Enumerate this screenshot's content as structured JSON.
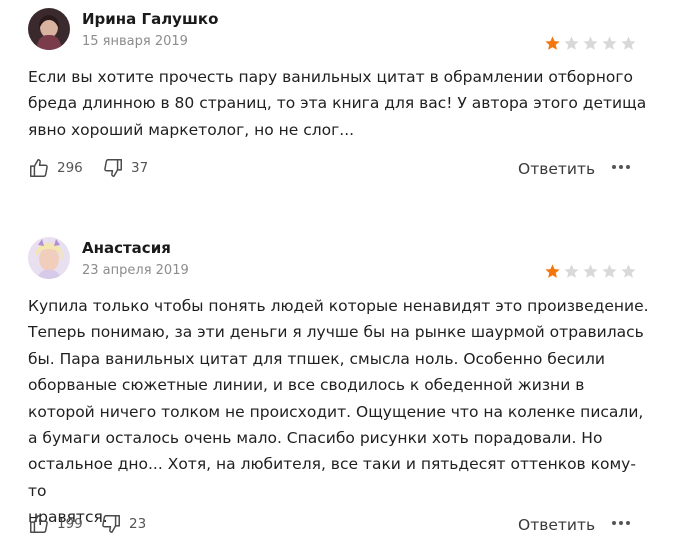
{
  "reviews": [
    {
      "author": "Ирина Галушко",
      "date": "15 января 2019",
      "rating": 1,
      "max_rating": 5,
      "text_lines": [
        "Если вы хотите прочесть пару ванильных цитат в обрамлении отборного",
        "бреда длинною в 80 страниц, то эта книга для вас! У автора этого детища",
        "явно хороший маркетолог, но не слог..."
      ],
      "likes": "296",
      "dislikes": "37",
      "reply_label": "Ответить"
    },
    {
      "author": "Анастасия",
      "date": "23 апреля 2019",
      "rating": 1,
      "max_rating": 5,
      "text_lines": [
        "Купила только чтобы понять людей которые ненавидят это произведение.",
        "Теперь понимаю, за эти деньги я лучше бы на рынке шаурмой отравилась",
        "бы. Пара ванильных цитат для тпшек, смысла ноль. Особенно бесили",
        "оборваные сюжетные линии, и все сводилось к обеденной жизни в",
        "которой ничего толком не происходит. Ощущение что на коленке писали,",
        "а бумаги осталось очень мало. Спасибо рисунки хоть порадовали. Но",
        "остальное дно... Хотя, на любителя, все таки и пятьдесят оттенков кому-то",
        "нравятся."
      ],
      "likes": "199",
      "dislikes": "23",
      "reply_label": "Ответить"
    }
  ],
  "colors": {
    "star_filled": "#f5760a",
    "star_empty": "#d9d9d9",
    "muted_text": "#8c8c8c"
  }
}
